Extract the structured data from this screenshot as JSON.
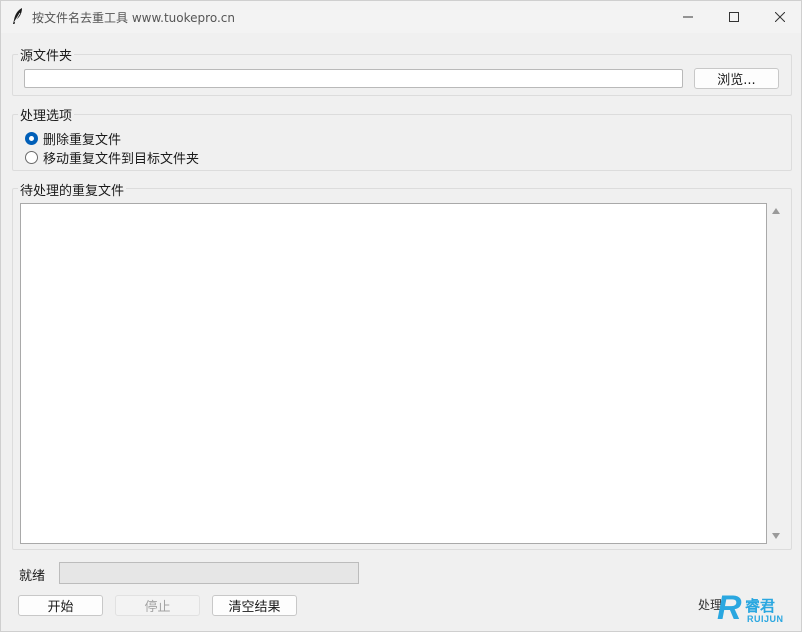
{
  "window": {
    "title": "按文件名去重工具 www.tuokepro.cn"
  },
  "source_group": {
    "label": "源文件夹",
    "path_value": "",
    "browse_label": "浏览..."
  },
  "options_group": {
    "label": "处理选项",
    "options": [
      {
        "label": "删除重复文件",
        "checked": true
      },
      {
        "label": "移动重复文件到目标文件夹",
        "checked": false
      }
    ]
  },
  "list_group": {
    "label": "待处理的重复文件"
  },
  "status": {
    "text": "就绪",
    "progress_percent": 0
  },
  "buttons": {
    "start": "开始",
    "stop": "停止",
    "clear": "清空结果"
  },
  "watermark": {
    "partial_text": "处理",
    "logo_letter": "R",
    "logo_cn": "睿君",
    "logo_en": "RUIJUN"
  },
  "colors": {
    "accent": "#005fb8",
    "watermark": "#2aa7e0"
  }
}
